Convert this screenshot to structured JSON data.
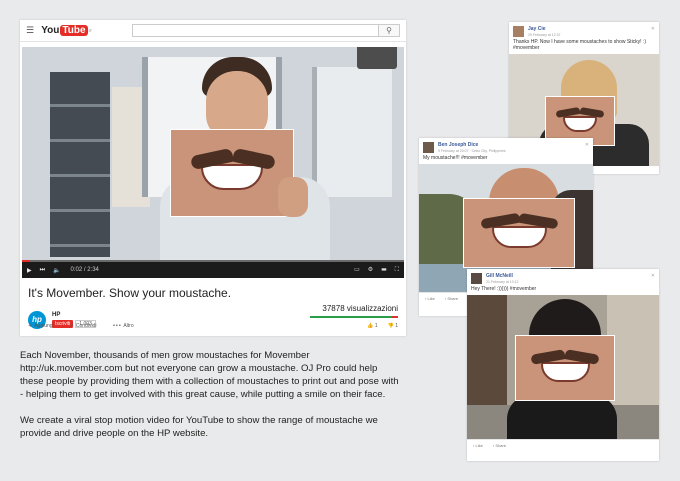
{
  "youtube": {
    "logo_you": "You",
    "logo_tube": "Tube",
    "logo_region": "IT",
    "search_placeholder": "",
    "video": {
      "time": "0:02 / 2:34",
      "progress": 0.02
    },
    "title": "It's Movember. Show your moustache.",
    "channel": {
      "logo_text": "hp",
      "name": "HP",
      "subscribe_label": "Iscriviti",
      "subscriber_count": "1.003"
    },
    "views": "37878 visualizzazioni",
    "actions": [
      {
        "icon": "plus-icon",
        "glyph": "+",
        "label": "Aggiungi"
      },
      {
        "icon": "share-icon",
        "glyph": "↗",
        "label": "Condividi"
      },
      {
        "icon": "more-icon",
        "glyph": "•••",
        "label": "Altro"
      }
    ],
    "likes": "1",
    "dislikes": "1"
  },
  "description": {
    "paragraph1": "Each November, thousands of men grow moustaches for Movember http://uk.movember.com but not everyone can grow a moustache. OJ Pro could help these people by providing them with a collection of moustaches to print out and pose with - helping them to get involved with this great cause, while putting a smile on their face.",
    "paragraph2": "We create a viral stop motion video for YouTube to show the range of moustache we provide and drive people on the HP website."
  },
  "facebook_posts": [
    {
      "name": "Jay Cie",
      "time": "29 February at 12:37",
      "text": "Thanks HP. Now I have some moustaches to show Sticky! :) #movember",
      "colors": {
        "photo": "#d9d4cc"
      }
    },
    {
      "name": "Ben Joseph Dice",
      "time": "9 February at 20:07 · Cebu City, Philippines",
      "text": "My moustache!!! #movember",
      "colors": {
        "photo": "#8fa6b5"
      }
    },
    {
      "name": "Gill McNeill",
      "time": "21 February at 13:12",
      "text": "Hey There! :)))))) #movember",
      "like": "Like",
      "share": "Share",
      "colors": {
        "photo": "#a7a196"
      }
    }
  ],
  "fb_like": "Like",
  "fb_share": "Share",
  "colors": {
    "youtube_red": "#e52d27",
    "hp_blue": "#0096d6",
    "facebook_blue": "#3b5998",
    "background": "#e9eaeb"
  }
}
